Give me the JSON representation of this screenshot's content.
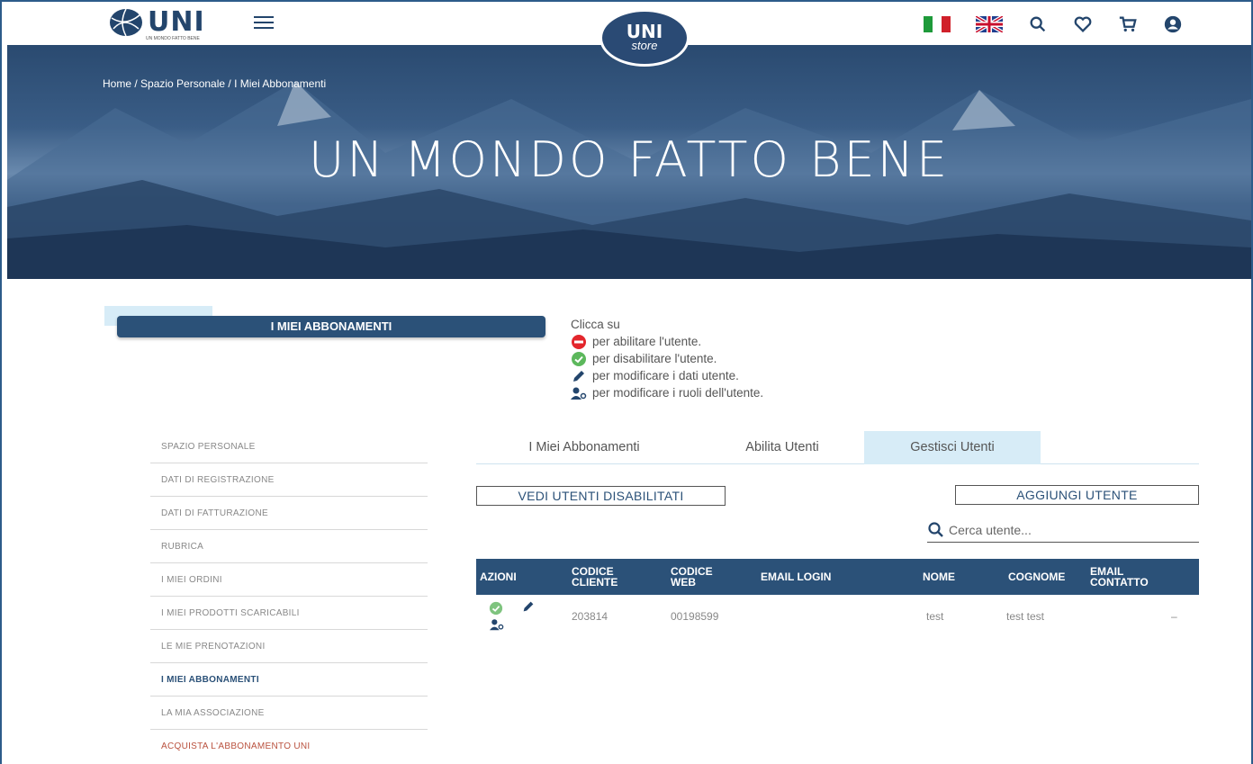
{
  "header": {
    "logo_text": "UNI",
    "logo_subtitle": "UN MONDO FATTO BENE",
    "store_line1": "UNI",
    "store_line2": "store"
  },
  "hero": {
    "breadcrumb": "Home / Spazio Personale / I Miei Abbonamenti",
    "title": "UN MONDO FATTO BENE"
  },
  "section": {
    "title": "I MIEI ABBONAMENTI"
  },
  "legend": {
    "intro": "Clicca su",
    "enable": "per abilitare l'utente.",
    "disable": "per disabilitare l'utente.",
    "edit": "per modificare i dati utente.",
    "roles": "per modificare i ruoli dell'utente."
  },
  "sidebar": {
    "items": [
      {
        "label": "SPAZIO PERSONALE"
      },
      {
        "label": "DATI DI REGISTRAZIONE"
      },
      {
        "label": "DATI DI FATTURAZIONE"
      },
      {
        "label": "RUBRICA"
      },
      {
        "label": "I MIEI ORDINI"
      },
      {
        "label": "I MIEI PRODOTTI SCARICABILI"
      },
      {
        "label": "LE MIE PRENOTAZIONI"
      },
      {
        "label": "I MIEI ABBONAMENTI"
      },
      {
        "label": "LA MIA ASSOCIAZIONE"
      },
      {
        "label": "ACQUISTA L'ABBONAMENTO UNI"
      }
    ]
  },
  "tabs": [
    {
      "label": "I Miei Abbonamenti"
    },
    {
      "label": "Abilita Utenti"
    },
    {
      "label": "Gestisci Utenti"
    }
  ],
  "actions": {
    "show_disabled": "VEDI UTENTI DISABILITATI",
    "add_user": "AGGIUNGI UTENTE"
  },
  "search": {
    "placeholder": "Cerca utente..."
  },
  "table": {
    "headers": {
      "azioni": "AZIONI",
      "codice_cliente_1": "CODICE",
      "codice_cliente_2": "CLIENTE",
      "codice_web_1": "CODICE",
      "codice_web_2": "WEB",
      "email_login": "EMAIL LOGIN",
      "nome": "NOME",
      "cognome": "COGNOME",
      "email_contatto_1": "EMAIL",
      "email_contatto_2": "CONTATTO"
    },
    "rows": [
      {
        "codice_cliente": "203814",
        "codice_web": "00198599",
        "email_login": "",
        "nome": "test",
        "cognome": "test test",
        "email_contatto": "–"
      }
    ]
  },
  "colors": {
    "brand": "#2b5178",
    "accent_light": "#d7ecf7",
    "enable_red": "#e3262c",
    "disable_green": "#5cb85c",
    "link_red": "#b9513e"
  },
  "icons": {
    "header": [
      "flag-italy-icon",
      "flag-uk-icon",
      "search-icon",
      "heart-icon",
      "cart-icon",
      "user-icon"
    ],
    "legend": [
      "minus-circle-icon",
      "check-circle-icon",
      "pencil-icon",
      "user-gear-icon"
    ]
  }
}
